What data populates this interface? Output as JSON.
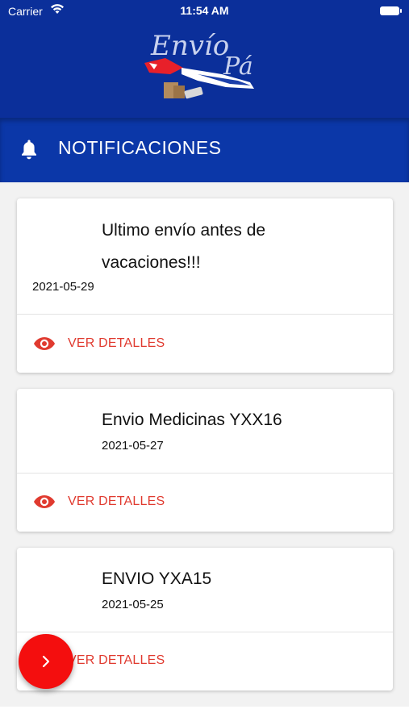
{
  "status_bar": {
    "carrier": "Carrier",
    "time": "11:54 AM"
  },
  "header": {
    "logo_text_line1": "Envío",
    "logo_text_line2": "Pá",
    "title": "NOTIFICACIONES"
  },
  "notifications": [
    {
      "title_line1": "Ultimo envío antes de",
      "title_line2": "vacaciones!!!",
      "date": "2021-05-29",
      "action_label": "VER DETALLES"
    },
    {
      "title_line1": "Envio Medicinas YXX16",
      "date": "2021-05-27",
      "action_label": "VER DETALLES"
    },
    {
      "title_line1": "ENVIO YXA15",
      "date": "2021-05-25",
      "action_label": "VER DETALLES"
    }
  ],
  "colors": {
    "header_bg": "#0b2f9a",
    "navbar_bg": "#0b37a8",
    "accent_red": "#e03a2f",
    "fab_red": "#f40e0e"
  },
  "icons": {
    "navbar": "bell-icon",
    "action": "eye-icon",
    "fab": "chevron-right-icon"
  }
}
